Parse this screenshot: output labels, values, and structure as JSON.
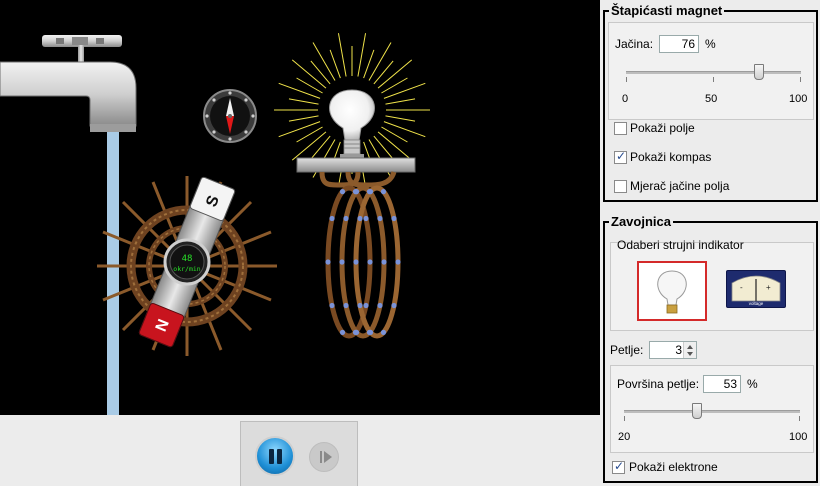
{
  "magnet_panel": {
    "title": "Štapićasti magnet",
    "strength_label": "Jačina:",
    "strength_value": "76",
    "strength_unit": "%",
    "slider": {
      "min_label": "0",
      "mid_label": "50",
      "max_label": "100",
      "value": 76,
      "min": 0,
      "max": 100
    },
    "show_field": {
      "label": "Pokaži polje",
      "checked": false
    },
    "show_compass": {
      "label": "Pokaži kompas",
      "checked": true
    },
    "field_meter": {
      "label": "Mjerač jačine polja",
      "checked": false
    }
  },
  "coil_panel": {
    "title": "Zavojnica",
    "indicator_label": "Odaberi strujni indikator",
    "indicator_options": [
      "bulb",
      "voltmeter"
    ],
    "selected_indicator": "bulb",
    "voltmeter_minus": "-",
    "voltmeter_plus": "+",
    "voltmeter_caption": "voltage",
    "loops_label": "Petlje:",
    "loops_value": "3",
    "area_label": "Površina petlje:",
    "area_value": "53",
    "area_unit": "%",
    "area_slider": {
      "min_label": "20",
      "max_label": "100",
      "value": 53,
      "min": 20,
      "max": 100
    },
    "show_electrons": {
      "label": "Pokaži elektrone",
      "checked": true
    }
  },
  "sim": {
    "magnet_pole_top": "S",
    "magnet_pole_bottom": "N",
    "wheel_readout_value": "48",
    "wheel_readout_unit": "okr/min"
  },
  "colors": {
    "canvas_bg": "#000000",
    "selected_border": "#d42a2a",
    "magnet_red": "#c8141e",
    "readout_green": "#28e028",
    "water": "#a9cbe6"
  }
}
